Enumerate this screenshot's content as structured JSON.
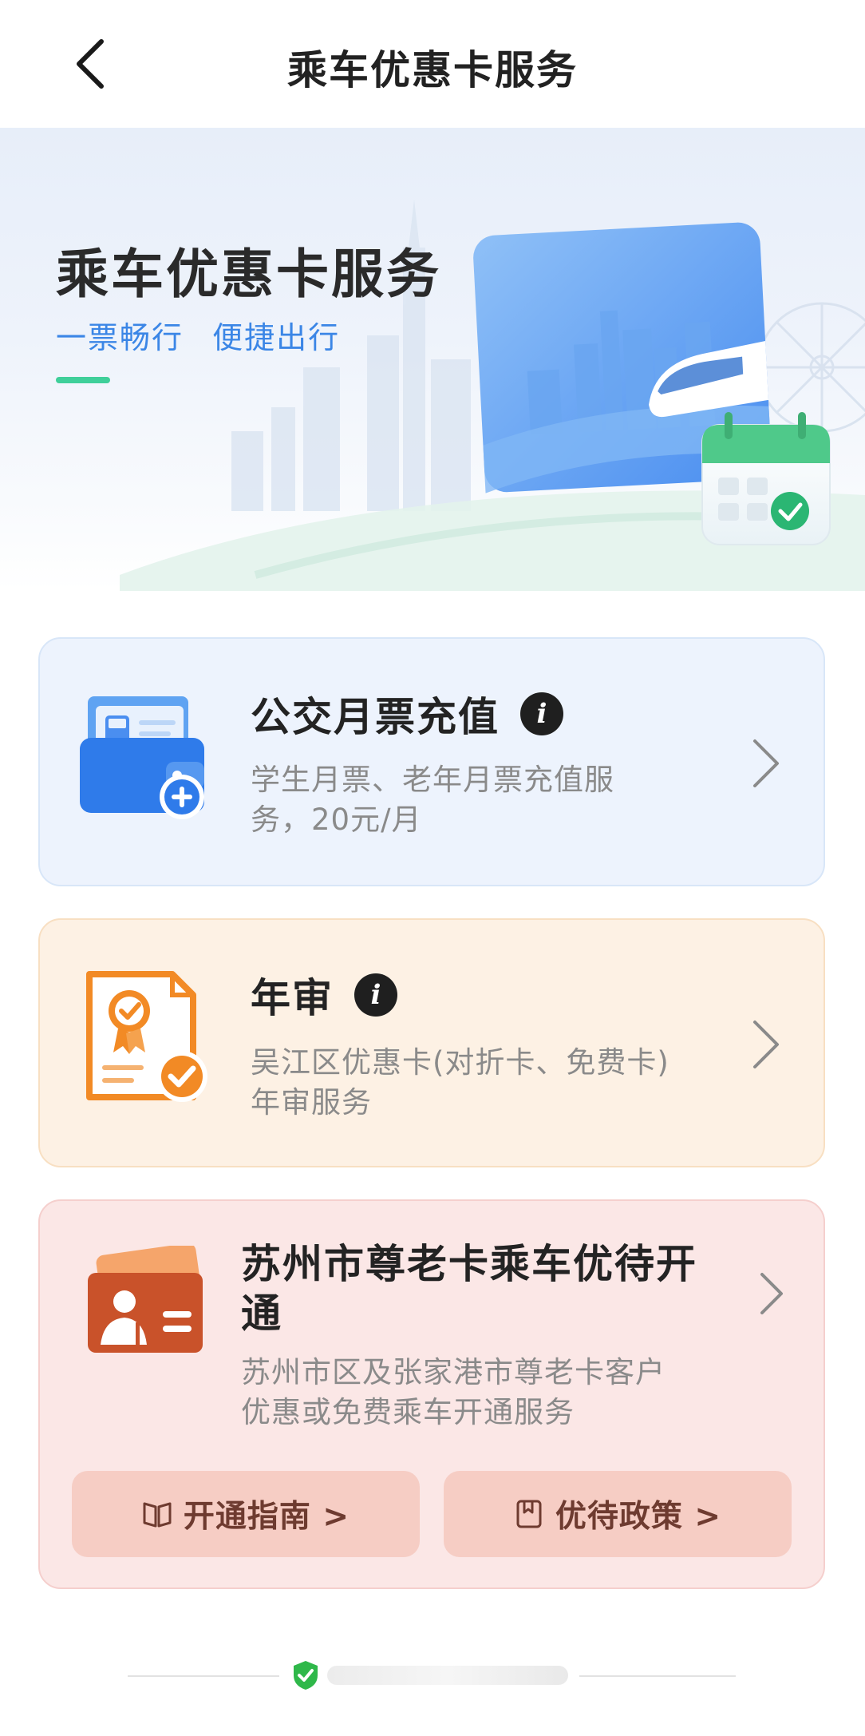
{
  "header": {
    "title": "乘车优惠卡服务",
    "back_icon": "chevron-left-icon"
  },
  "banner": {
    "title": "乘车优惠卡服务",
    "slogan": "一票畅行 便捷出行",
    "accent_color": "#3fcf9a",
    "slogan_color": "#3b86e6"
  },
  "cards": [
    {
      "title": "公交月票充值",
      "desc_line1": "学生月票、老年月票充值服",
      "desc_line2": "务，20元/月",
      "icon": "wallet-add-icon",
      "info_glyph": "i",
      "bg_color": "#edf3fd"
    },
    {
      "title": "年审",
      "desc_line1": "吴江区优惠卡(对折卡、免费卡)",
      "desc_line2": "年审服务",
      "icon": "certificate-check-icon",
      "info_glyph": "i",
      "bg_color": "#fdf1e4"
    },
    {
      "title_line1": "苏州市尊老卡乘车优待开",
      "title_line2": "通",
      "desc_line1": "苏州市区及张家港市尊老卡客户",
      "desc_line2": "优惠或免费乘车开通服务",
      "icon": "senior-card-icon",
      "bg_color": "#fbe7e6",
      "buttons": [
        {
          "label": "开通指南 >",
          "icon": "book-open-icon"
        },
        {
          "label": "优待政策 >",
          "icon": "bookmark-icon"
        }
      ]
    }
  ],
  "footer": {
    "icon": "shield-check-icon"
  }
}
